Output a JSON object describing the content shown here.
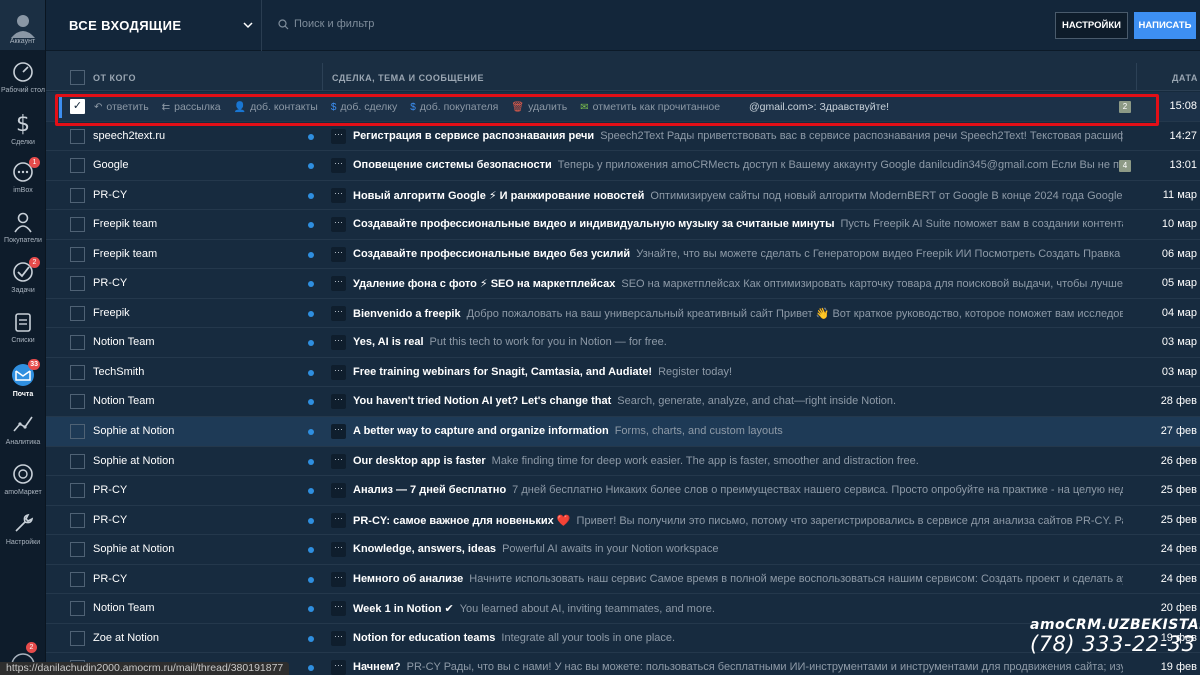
{
  "sidebar": {
    "account_label": "Аккаунт",
    "items": [
      {
        "label": "Рабочий стол",
        "icon": "dashboard-icon",
        "badge": ""
      },
      {
        "label": "Сделки",
        "icon": "dollar-icon",
        "badge": ""
      },
      {
        "label": "imBox",
        "icon": "chat-icon",
        "badge": "1"
      },
      {
        "label": "Покупатели",
        "icon": "customers-icon",
        "badge": ""
      },
      {
        "label": "Задачи",
        "icon": "tasks-icon",
        "badge": "2"
      },
      {
        "label": "Списки",
        "icon": "lists-icon",
        "badge": ""
      },
      {
        "label": "Почта",
        "icon": "mail-icon",
        "badge": "33",
        "active": true
      },
      {
        "label": "Аналитика",
        "icon": "analytics-icon",
        "badge": ""
      },
      {
        "label": "amoМаркет",
        "icon": "market-icon",
        "badge": ""
      },
      {
        "label": "Настройки",
        "icon": "settings-icon",
        "badge": ""
      }
    ],
    "bottom_badge": "2"
  },
  "header": {
    "title": "ВСЕ ВХОДЯЩИЕ",
    "search_placeholder": "Поиск и фильтр",
    "settings_button": "НАСТРОЙКИ",
    "write_button": "НАПИСАТЬ"
  },
  "columns": {
    "from": "ОТ КОГО",
    "subject": "СДЕЛКА, ТЕМА И СООБЩЕНИЕ",
    "date": "ДАТА"
  },
  "selected_row": {
    "actions": [
      {
        "label": "ответить",
        "icon": "reply-icon"
      },
      {
        "label": "рассылка",
        "icon": "reply-all-icon"
      },
      {
        "label": "доб. контакты",
        "icon": "add-contact-icon"
      },
      {
        "label": "доб. сделку",
        "icon": "add-deal-icon"
      },
      {
        "label": "доб. покупателя",
        "icon": "add-customer-icon"
      },
      {
        "label": "удалить",
        "icon": "trash-icon"
      },
      {
        "label": "отметить как прочитанное",
        "icon": "mark-read-icon"
      }
    ],
    "message": "@gmail.com>: Здравствуйте!",
    "count": "2",
    "date": "15:08"
  },
  "emails": [
    {
      "from": "speech2text.ru",
      "subject": "Регистрация в сервисе распознавания речи",
      "preview": "Speech2Text Рады приветствовать вас в сервисе распознавания речи Speech2Text! Текстовая расшифровка ва",
      "count": "",
      "date": "14:27"
    },
    {
      "from": "Google",
      "subject": "Оповещение системы безопасности",
      "preview": "Теперь у приложения amoCRMесть доступ к Вашему аккаунту Google danilcudin345@gmail.com Если Вы не предо",
      "count": "4",
      "date": "13:01"
    },
    {
      "from": "PR-CY",
      "subject": "Новый алгоритм Google ⚡ И ранжирование новостей",
      "preview": "Оптимизируем сайты под новый алгоритм ModernBERT от Google В конце 2024 года Google предс",
      "count": "",
      "date": "11 мар"
    },
    {
      "from": "Freepik team",
      "subject": "Создавайте профессиональные видео и индивидуальную музыку за считаные минуты",
      "preview": "Пусть Freepik AI Suite поможет вам в создании контента   AI Images",
      "count": "",
      "date": "10 мар"
    },
    {
      "from": "Freepik team",
      "subject": "Создавайте профессиональные видео без усилий",
      "preview": "Узнайте, что вы можете сделать с Генератором видео Freepik ИИ   Посмотреть Создать Правка   ИССЛЕДУ",
      "count": "",
      "date": "06 мар"
    },
    {
      "from": "PR-CY",
      "subject": "Удаление фона с фото ⚡ SEO на маркетплейсах",
      "preview": "SEO на маркетплейсах Как оптимизировать карточку товара для поисковой выдачи, чтобы лучше ранж",
      "count": "",
      "date": "05 мар"
    },
    {
      "from": "Freepik",
      "subject": "Bienvenido a freepik",
      "preview": "Добро пожаловать на ваш универсальный креативный сайт Привет 👋 Вот краткое руководство, которое поможет вам исследовать F",
      "count": "",
      "date": "04 мар"
    },
    {
      "from": "Notion Team",
      "subject": "Yes, AI is real",
      "preview": "Put this tech to work for you in Notion — for free.",
      "count": "",
      "date": "03 мар"
    },
    {
      "from": "TechSmith",
      "subject": "Free training webinars for Snagit, Camtasia, and Audiate!",
      "preview": "Register today!",
      "count": "",
      "date": "03 мар"
    },
    {
      "from": "Notion Team",
      "subject": "You haven't tried Notion AI yet? Let's change that",
      "preview": "Search, generate, analyze, and chat—right inside Notion.",
      "count": "",
      "date": "28 фев"
    },
    {
      "from": "Sophie at Notion",
      "subject": "A better way to capture and organize information",
      "preview": "Forms, charts, and custom layouts",
      "count": "",
      "date": "27 фев",
      "highlight": true
    },
    {
      "from": "Sophie at Notion",
      "subject": "Our desktop app is faster",
      "preview": "Make finding time for deep work easier. The app is faster, smoother and distraction free.",
      "count": "",
      "date": "26 фев"
    },
    {
      "from": "PR-CY",
      "subject": "Анализ — 7 дней бесплатно",
      "preview": "7 дней бесплатно Никаких более слов о преимуществах нашего сервиса. Просто опробуйте на практике - на целую неделю бе",
      "count": "",
      "date": "25 фев"
    },
    {
      "from": "PR-CY",
      "subject": "PR-CY: самое важное для новеньких ❤️",
      "preview": "Привет! Вы получили это письмо, потому что зарегистрировались в сервисе для анализа сайтов PR-CY. Раз в нед",
      "count": "",
      "date": "25 фев"
    },
    {
      "from": "Sophie at Notion",
      "subject": "Knowledge, answers, ideas",
      "preview": "Powerful AI awaits in your Notion workspace",
      "count": "",
      "date": "24 фев"
    },
    {
      "from": "PR-CY",
      "subject": "Немного об анализе",
      "preview": "Начните использовать наш сервис Самое время в полной мере воспользоваться нашим сервисом: Создать проект и сделать аудит са",
      "count": "",
      "date": "24 фев"
    },
    {
      "from": "Notion Team",
      "subject": "Week 1 in Notion ✔",
      "preview": "You learned about AI, inviting teammates, and more.",
      "count": "",
      "date": "20 фев"
    },
    {
      "from": "Zoe at Notion",
      "subject": "Notion for education teams",
      "preview": "Integrate all your tools in one place.",
      "count": "",
      "date": "19 фев"
    },
    {
      "from": "PR-CY",
      "subject": "Начнем?",
      "preview": "PR-CY Рады, что вы с нами! У нас вы можете: пользоваться бесплатными ИИ-инструментами и инструментами для продвижения сайта; изучать п",
      "count": "",
      "date": "19 фев"
    }
  ],
  "statusbar": "https://danilachudin2000.amocrm.ru/mail/thread/380191877",
  "brand": {
    "name": "amoCRM.UZBEKISTAN",
    "phone": "(78) 333-22-33"
  }
}
